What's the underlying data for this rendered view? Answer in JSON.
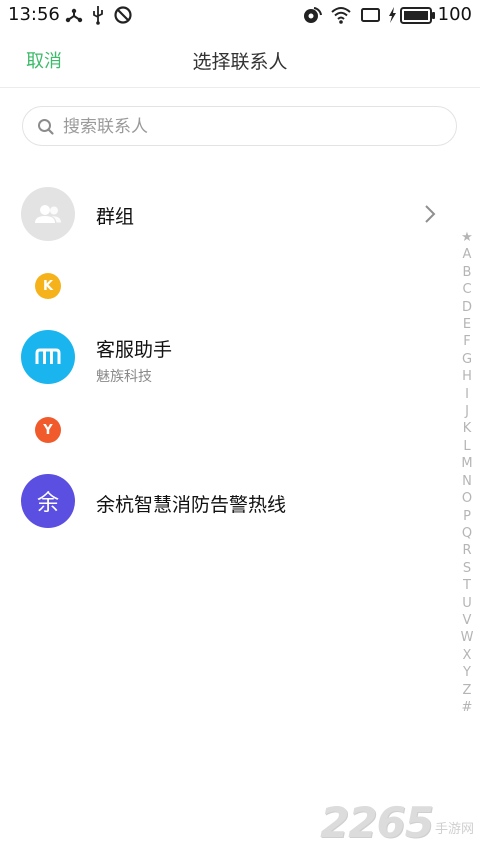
{
  "status_bar": {
    "time": "13:56",
    "battery": "100",
    "icons": [
      "share-icon",
      "usb-icon",
      "do-not-disturb-icon",
      "data-icon",
      "wifi-icon",
      "screen-icon",
      "charging-icon",
      "battery-icon"
    ]
  },
  "header": {
    "cancel_label": "取消",
    "title": "选择联系人"
  },
  "search": {
    "placeholder": "搜索联系人",
    "value": ""
  },
  "group": {
    "label": "群组",
    "icon": "group-icon"
  },
  "sections": [
    {
      "letter": "K",
      "color": "#f6b21b",
      "contacts": [
        {
          "name": "客服助手",
          "subtitle": "魅族科技",
          "avatar_color": "#1ab5ee",
          "avatar_icon": "meizu-logo-icon"
        }
      ]
    },
    {
      "letter": "Y",
      "color": "#f15a2b",
      "contacts": [
        {
          "name": "余杭智慧消防告警热线",
          "subtitle": "",
          "avatar_color": "#5a4fe0",
          "avatar_text": "余"
        }
      ]
    }
  ],
  "alpha_index": [
    "★",
    "A",
    "B",
    "C",
    "D",
    "E",
    "F",
    "G",
    "H",
    "I",
    "J",
    "K",
    "L",
    "M",
    "N",
    "O",
    "P",
    "Q",
    "R",
    "S",
    "T",
    "U",
    "V",
    "W",
    "X",
    "Y",
    "Z",
    "#"
  ],
  "watermark": {
    "number": "2265",
    "text": "手游网"
  },
  "colors": {
    "accent": "#3dba6a",
    "group_avatar": "#e3e3e3"
  }
}
